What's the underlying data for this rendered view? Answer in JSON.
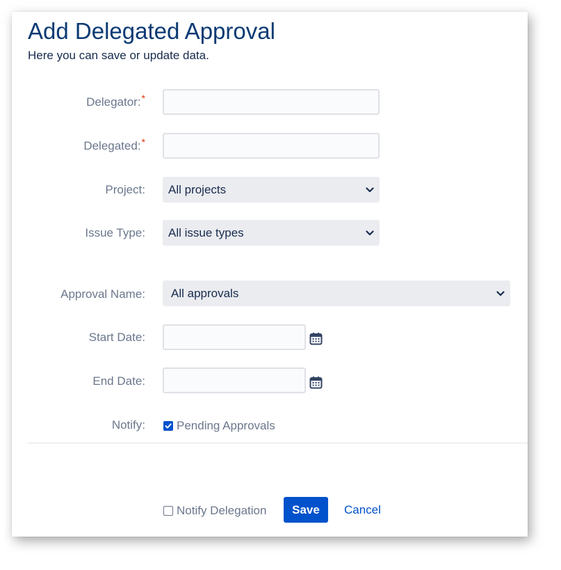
{
  "dialog": {
    "title": "Add Delegated Approval",
    "subtitle": "Here you can save or update data."
  },
  "form": {
    "delegator": {
      "label": "Delegator:",
      "required_marker": "*",
      "value": ""
    },
    "delegated": {
      "label": "Delegated:",
      "required_marker": "*",
      "value": ""
    },
    "project": {
      "label": "Project:",
      "selected": "All projects"
    },
    "issue_type": {
      "label": "Issue Type:",
      "selected": "All issue types"
    },
    "approval_name": {
      "label": "Approval Name:",
      "selected": "All approvals"
    },
    "start_date": {
      "label": "Start Date:",
      "value": "",
      "icon": "calendar-icon"
    },
    "end_date": {
      "label": "End Date:",
      "value": "",
      "icon": "calendar-icon"
    },
    "notify": {
      "label": "Notify:",
      "option_label": "Pending Approvals",
      "checked": true
    }
  },
  "footer": {
    "notify_delegation_label": "Notify Delegation",
    "notify_delegation_checked": false,
    "save_label": "Save",
    "cancel_label": "Cancel"
  },
  "colors": {
    "title": "#0b3a73",
    "accent": "#0052cc",
    "required": "#de350b",
    "label": "#6b778c",
    "select_bg": "#ebecf0"
  }
}
